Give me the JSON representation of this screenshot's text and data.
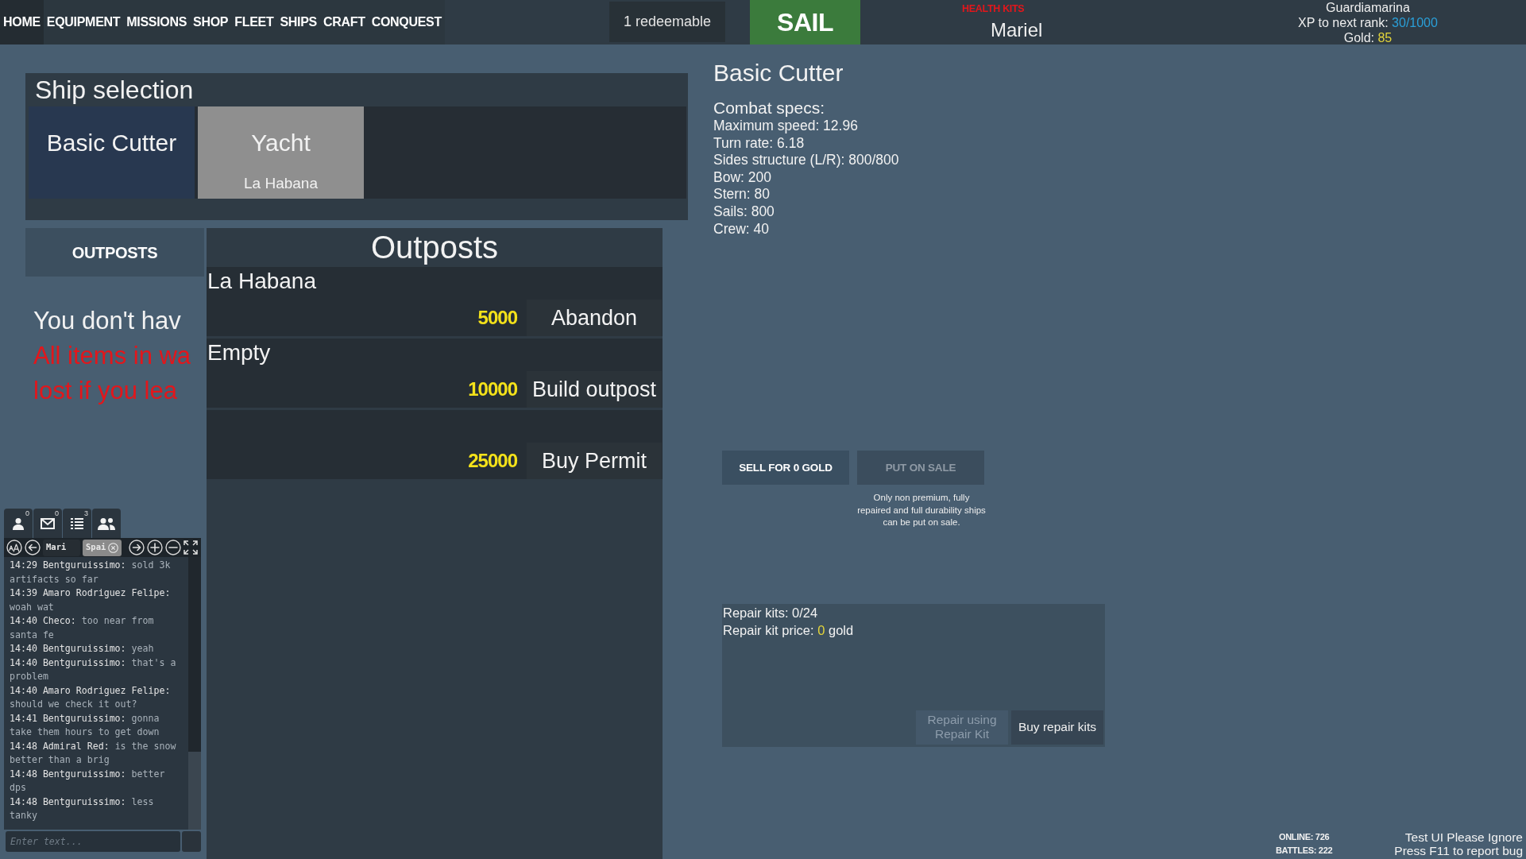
{
  "top_bar": {
    "nav": [
      {
        "label": "HOME",
        "selected": true
      },
      {
        "label": "EQUIPMENT",
        "selected": false
      },
      {
        "label": "MISSIONS",
        "selected": false
      },
      {
        "label": "SHOP",
        "selected": false
      },
      {
        "label": "FLEET",
        "selected": false
      },
      {
        "label": "SHIPS",
        "selected": false
      },
      {
        "label": "CRAFT",
        "selected": false
      },
      {
        "label": "CONQUEST",
        "selected": false
      }
    ],
    "redeem_button": "1 redeemable",
    "sail_button": "SAIL",
    "health_kits": "HEALTH KITS",
    "player_name": "Mariel",
    "rank": "Guardiamarina",
    "xp_label": "XP to next rank:",
    "xp_value": "30/1000",
    "gold_label": "Gold:",
    "gold_value": "85"
  },
  "ship_selection": {
    "title": "Ship selection",
    "ships": [
      {
        "name": "Basic Cutter",
        "selected": true
      },
      {
        "name": "Yacht",
        "location": "La Habana",
        "selected": false
      }
    ]
  },
  "side_tabs": [
    {
      "label": "OUTPOSTS",
      "selected": true
    }
  ],
  "notice": [
    {
      "kind": "info",
      "text": "You don't hav"
    },
    {
      "kind": "warning",
      "text": "All items in wa"
    },
    {
      "kind": "warning",
      "text": "lost if you lea"
    }
  ],
  "outposts": {
    "title": "Outposts",
    "rows": [
      {
        "name": "La Habana",
        "price": "5000",
        "action": "Abandon"
      },
      {
        "name": "Empty",
        "price": "10000",
        "action": "Build outpost"
      },
      {
        "price": "25000",
        "action": "Buy Permit"
      }
    ]
  },
  "ship_details": {
    "title": "Basic Cutter",
    "specs_heading": "Combat specs:",
    "specs": [
      "Maximum speed: 12.96",
      "Turn rate: 6.18",
      "Sides structure (L/R): 800/800",
      "Bow: 200",
      "Stern: 80",
      "Sails: 800",
      "Crew: 40"
    ]
  },
  "sale": {
    "buttons": [
      {
        "label": "SELL FOR 0 GOLD",
        "disabled": false
      },
      {
        "label": "PUT ON SALE",
        "disabled": true
      }
    ],
    "note": "Only non premium, fully repaired and full durability ships can be put on sale."
  },
  "repair": {
    "kits": "Repair kits: 0/24",
    "price_label": "Repair kit price:",
    "price_value": "0",
    "price_unit": "gold",
    "buttons": [
      {
        "label": "Repair using Repair Kit",
        "disabled": true
      },
      {
        "label": "Buy repair kits",
        "disabled": false
      }
    ]
  },
  "chat": {
    "panel_tabs": [
      {
        "kind": "person",
        "count": "0"
      },
      {
        "kind": "mail",
        "count": "0"
      },
      {
        "kind": "list",
        "count": "3"
      },
      {
        "kind": "group"
      }
    ],
    "channels": [
      {
        "label": "Mari",
        "selected": false
      },
      {
        "label": "Spai",
        "selected": true
      }
    ],
    "messages": [
      {
        "head": "14:29 Bentguruissimo:",
        "text": "sold 3k artifacts so far"
      },
      {
        "head": "14:39 Amaro Rodriguez Felipe:",
        "text": "woah wat"
      },
      {
        "head": "14:40 Checo:",
        "text": "too near from santa fe"
      },
      {
        "head": "14:40 Bentguruissimo:",
        "text": "yeah"
      },
      {
        "head": "14:40 Bentguruissimo:",
        "text": "that's a problem"
      },
      {
        "head": "14:40 Amaro Rodriguez Felipe:",
        "text": "should we check it out?"
      },
      {
        "head": "14:41 Bentguruissimo:",
        "text": "gonna take them hours to get down"
      },
      {
        "head": "14:48 Admiral Red:",
        "text": "is the snow better than a brig"
      },
      {
        "head": "14:48 Bentguruissimo:",
        "text": "better dps"
      },
      {
        "head": "14:48 Bentguruissimo:",
        "text": "less tanky"
      }
    ],
    "input": {
      "placeholder": "Enter text..."
    }
  },
  "footer": {
    "online": "ONLINE: 726",
    "battles": "BATTLES: 222",
    "notes": [
      "Test UI Please Ignore",
      "Press F11 to report bug"
    ]
  }
}
